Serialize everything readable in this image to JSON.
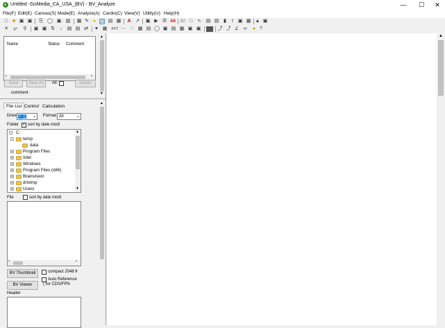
{
  "window": {
    "title": "Untitled -SciMedia_CA_USA_(BV) - BV_Analyze",
    "min_icon": "minimize-icon",
    "max_icon": "maximize-icon",
    "close_icon": "close-icon"
  },
  "menu": [
    "File(F)",
    "Edit(E)",
    "Canvas(S)",
    "Mode(E)",
    "Analyze(A)",
    "Cardio(C)",
    "View(V)",
    "Utility(U)",
    "Help(H)"
  ],
  "toolbar1": {
    "abs_label": "All",
    "threed_label": "3D"
  },
  "toolbar2": {
    "fft_label": "FFT"
  },
  "list_panel": {
    "col_name": "Name",
    "col_status": "Status",
    "col_comment": "Comment",
    "save": "Save",
    "save_as": "Save As",
    "all": "All",
    "delete": "Delete",
    "comment_label": "comment"
  },
  "tabs": [
    "File List",
    "Control",
    "Calculation"
  ],
  "file_list": {
    "drive_label": "Drive",
    "drive_value": "c: []",
    "format_label": "Format",
    "format_value": "All",
    "folder_label": "Folder",
    "sort_folder": "sort by date modi",
    "tree": [
      "C:",
      "temp",
      "data",
      "Program Files",
      "Intel",
      "Windows",
      "Program Files (x86)",
      "Brainvision",
      "drivtmp",
      "Users"
    ],
    "file_label": "File",
    "sort_file": "sort by date modi",
    "bv_thumbnail": "BV Thumbnail",
    "bv_viewer": "BV Viewer",
    "compact": "compact 2048 fr",
    "auto_ref": "Auto Reference",
    "auto_ref_sub": "( for CDS/FPN",
    "header_label": "Header"
  }
}
